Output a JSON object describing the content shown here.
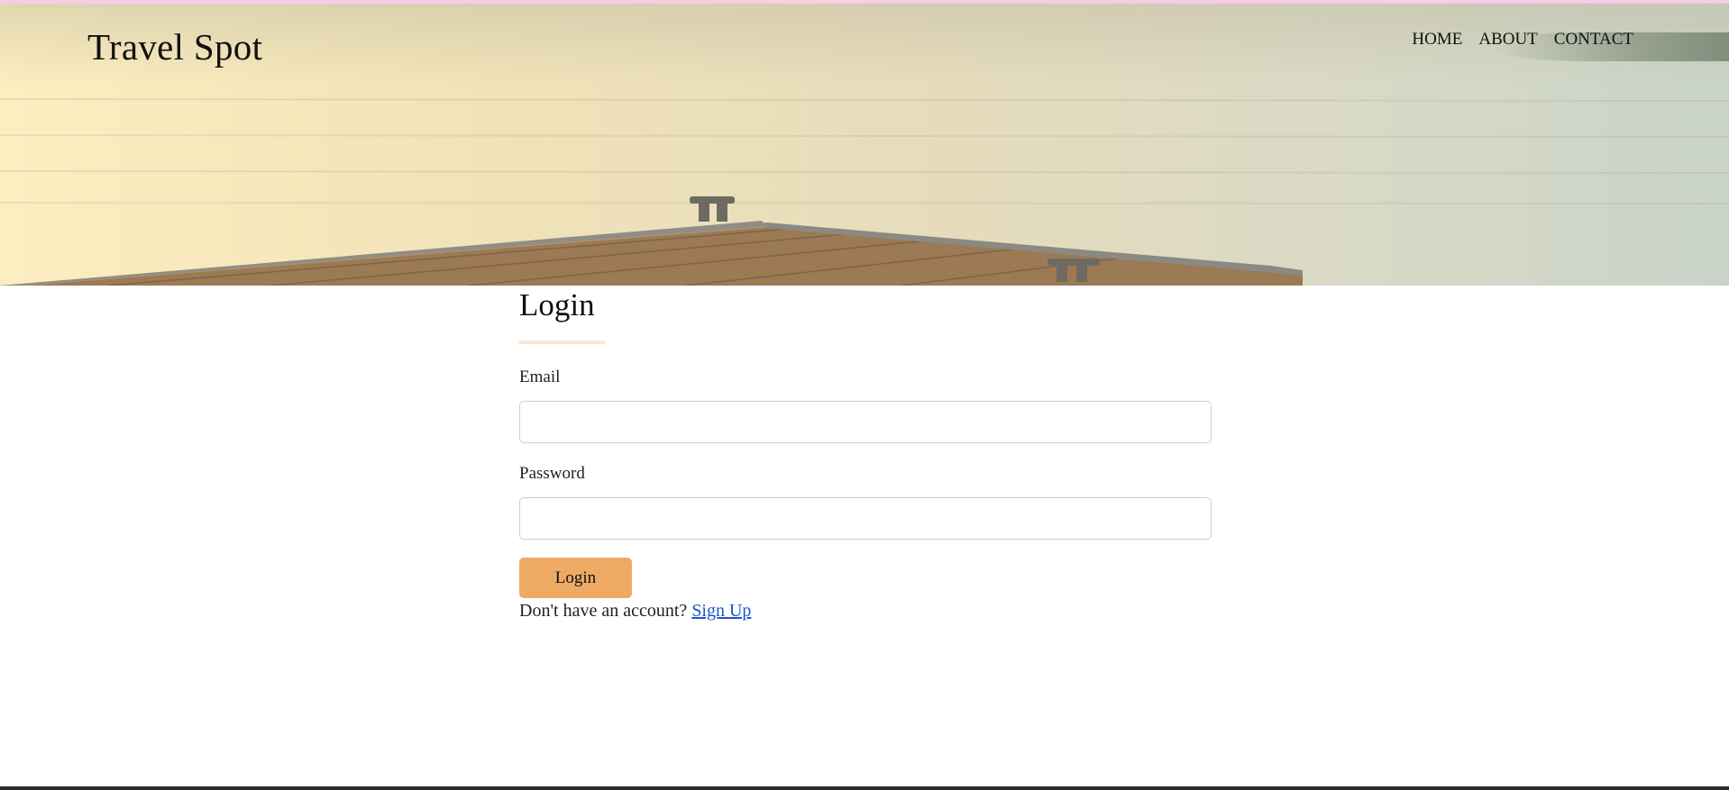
{
  "header": {
    "brand": "Travel Spot",
    "nav": [
      {
        "label": "HOME"
      },
      {
        "label": "ABOUT"
      },
      {
        "label": "CONTACT"
      }
    ]
  },
  "login": {
    "title": "Login",
    "email_label": "Email",
    "email_value": "",
    "password_label": "Password",
    "password_value": "",
    "submit_label": "Login",
    "signup_prompt": "Don't have an account?",
    "signup_link": "Sign Up"
  },
  "colors": {
    "accent": "#eeaa65",
    "link": "#1a56c8",
    "underline": "#fae6d6"
  }
}
